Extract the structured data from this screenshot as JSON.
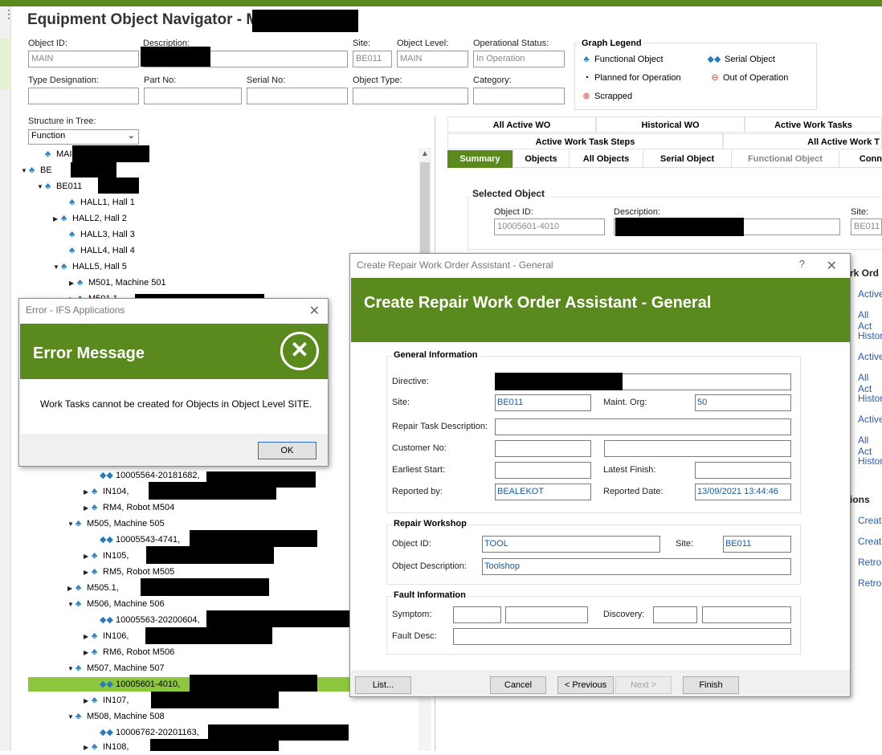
{
  "window": {
    "title": "Equipment Object Navigator - MAIN"
  },
  "header_fields": {
    "object_id_label": "Object ID:",
    "object_id": "MAIN",
    "description_label": "Description:",
    "site_label": "Site:",
    "site": "BE011",
    "object_level_label": "Object Level:",
    "object_level": "MAIN",
    "operational_status_label": "Operational Status:",
    "operational_status": "In Operation",
    "type_designation_label": "Type Designation:",
    "part_no_label": "Part No:",
    "serial_no_label": "Serial No:",
    "object_type_label": "Object Type:",
    "category_label": "Category:"
  },
  "legend": {
    "title": "Graph Legend",
    "functional": "Functional Object",
    "serial": "Serial Object",
    "planned": "Planned for Operation",
    "out": "Out of Operation",
    "scrapped": "Scrapped"
  },
  "tree": {
    "structure_label": "Structure in Tree:",
    "structure_value": "Function",
    "rows": [
      {
        "text": "MAIN"
      },
      {
        "text": "BE"
      },
      {
        "text": "BE011"
      },
      {
        "text": "HALL1,  Hall 1"
      },
      {
        "text": "HALL2,  Hall 2"
      },
      {
        "text": "HALL3,  Hall 3"
      },
      {
        "text": "HALL4,  Hall 4"
      },
      {
        "text": "HALL5,  Hall 5"
      },
      {
        "text": "M501,  Machine 501"
      },
      {
        "text": "M501.1"
      },
      {
        "text": "10005564-20181682,"
      },
      {
        "text": "IN104,"
      },
      {
        "text": "RM4,  Robot M504"
      },
      {
        "text": "M505,  Machine 505"
      },
      {
        "text": "10005543-4741,"
      },
      {
        "text": "IN105,"
      },
      {
        "text": "RM5,  Robot M505"
      },
      {
        "text": "M505.1,"
      },
      {
        "text": "M506,  Machine 506"
      },
      {
        "text": "10005563-20200604,"
      },
      {
        "text": "IN106,"
      },
      {
        "text": "RM6,  Robot M506"
      },
      {
        "text": "M507,  Machine 507"
      },
      {
        "text": "10005601-4010,"
      },
      {
        "text": "IN107,"
      },
      {
        "text": "M508,  Machine 508"
      },
      {
        "text": "10006762-20201163,"
      },
      {
        "text": "IN108,"
      }
    ]
  },
  "tabs_row1": [
    "All Active WO",
    "Historical WO",
    "Active Work Tasks"
  ],
  "tabs_row2": [
    "Active Work Task Steps",
    "All Active Work T"
  ],
  "tabs_row3": [
    "Summary",
    "Objects",
    "All Objects",
    "Serial Object",
    "Functional Object",
    "Conn"
  ],
  "selected_object": {
    "title": "Selected Object",
    "object_id_label": "Object ID:",
    "object_id": "10005601-4010",
    "description_label": "Description:",
    "site_label": "Site:",
    "site": "BE011"
  },
  "right_links": {
    "section1": "rk Ord",
    "items1": [
      "Active",
      "All Act",
      "Histori",
      "Active",
      "All Act",
      "Histori",
      "Active",
      "All Act",
      "Histori"
    ],
    "section2": "ions",
    "items2": [
      "Creat",
      "Creat",
      "Retro",
      "Retro"
    ]
  },
  "error_dialog": {
    "caption": "Error - IFS Applications",
    "heading": "Error Message",
    "message": "Work Tasks cannot be created for Objects in Object Level SITE.",
    "ok": "OK"
  },
  "wizard": {
    "caption": "Create Repair Work Order Assistant - General",
    "help": "?",
    "heading": "Create Repair Work Order Assistant - General",
    "general_info": "General Information",
    "directive_label": "Directive:",
    "site_label": "Site:",
    "site": "BE011",
    "maint_org_label": "Maint. Org:",
    "maint_org": "50",
    "repair_task_desc_label": "Repair Task Description:",
    "customer_no_label": "Customer No:",
    "earliest_start_label": "Earliest Start:",
    "latest_finish_label": "Latest Finish:",
    "reported_by_label": "Reported by:",
    "reported_by": "BEALEKOT",
    "reported_date_label": "Reported Date:",
    "reported_date": "13/09/2021 13:44:46",
    "repair_workshop": "Repair Workshop",
    "ws_object_id_label": "Object ID:",
    "ws_object_id": "TOOL",
    "ws_site_label": "Site:",
    "ws_site": "BE011",
    "ws_object_desc_label": "Object Description:",
    "ws_object_desc": "Toolshop",
    "fault_info": "Fault Information",
    "symptom_label": "Symptom:",
    "discovery_label": "Discovery:",
    "fault_desc_label": "Fault Desc:",
    "list_btn": "List...",
    "cancel_btn": "Cancel",
    "prev_btn": "< Previous",
    "next_btn": "Next >",
    "finish_btn": "Finish"
  },
  "colors": {
    "accent": "#5a8a1e",
    "selected_row": "#8dc63f",
    "link": "#2a5ca8"
  }
}
